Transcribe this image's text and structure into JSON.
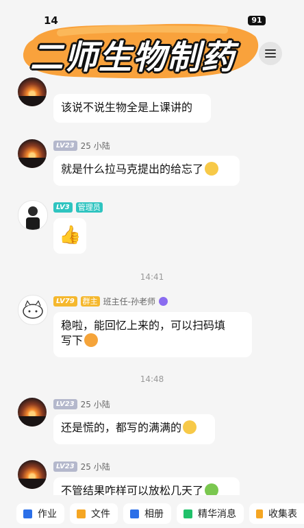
{
  "status_bar": {
    "time": "14",
    "battery": "91"
  },
  "header": {
    "title_overlay": "二师生物制药"
  },
  "messages": [
    {
      "text": "该说不说生物全是上课讲的"
    },
    {
      "level": "LV23",
      "sender": "25 小陆",
      "text": "就是什么拉马克提出的给忘了"
    },
    {
      "level": "LV3",
      "role": "管理员",
      "text": "👍"
    },
    {
      "timestamp": "14:41"
    },
    {
      "level": "LV79",
      "role": "群主",
      "sender": "班主任-孙老师",
      "text_line1": "稳啦，能回忆上来的，可以扫码填",
      "text_line2": "写下"
    },
    {
      "timestamp": "14:48"
    },
    {
      "level": "LV23",
      "sender": "25 小陆",
      "text": "还是慌的，都写的满满的"
    },
    {
      "level": "LV23",
      "sender": "25 小陆",
      "text": "不管结果咋样可以放松几天了"
    }
  ],
  "toolbar": {
    "items": [
      {
        "label": "作业",
        "icon": "homework-icon",
        "color": "#2b6fe8"
      },
      {
        "label": "文件",
        "icon": "folder-icon",
        "color": "#f5a623"
      },
      {
        "label": "相册",
        "icon": "album-icon",
        "color": "#2b6fe8"
      },
      {
        "label": "精华消息",
        "icon": "essence-icon",
        "color": "#20c16a"
      },
      {
        "label": "收集表",
        "icon": "form-icon",
        "color": "#f5a623"
      }
    ]
  }
}
